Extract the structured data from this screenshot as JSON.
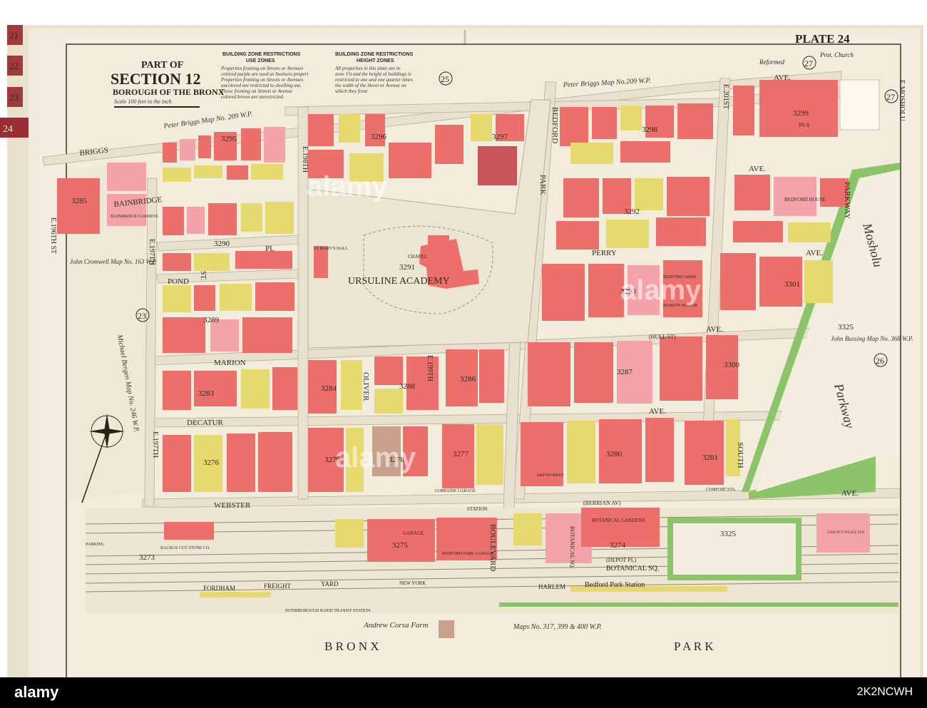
{
  "plate": "PLATE 24",
  "title": {
    "line1": "PART OF",
    "line2": "SECTION 12",
    "line3": "BOROUGH OF THE BRONX",
    "scale": "Scale 100 feet to the inch"
  },
  "legend_use": {
    "heading1": "BUILDING ZONE RESTRICTIONS",
    "heading2": "USE ZONES",
    "lines": [
      "Properties fronting on Streets or Avenues",
      "colored purple are used as business propert",
      "Properties fronting on Streets or Avenues",
      "uncolored are restricted to dwelling use.",
      "Those fronting on Streets or Avenue",
      "colored brown are unrestricted."
    ]
  },
  "legend_height": {
    "heading1": "BUILDING ZONE RESTRICTIONS",
    "heading2": "HEIGHT ZONES",
    "lines": [
      "All properties in this plate are in",
      "zone 1¼ and the height of buildings is",
      "restricted to one and one quarter times",
      "the width of the Street or Avenue on",
      "which they front"
    ]
  },
  "tabs": [
    "21",
    "22",
    "23",
    "24"
  ],
  "streets": {
    "briggs": "BRIGGS",
    "bainbridge": "BAINBRIDGE",
    "pond": "POND",
    "pl": "PL",
    "marion": "MARION",
    "decatur": "DECATUR",
    "webster": "WEBSTER",
    "perry": "PERRY",
    "ave": "AVE.",
    "hull": "(HULL ST)",
    "bedford": "BEDFORD",
    "park": "PARK",
    "boulevard": "BOULEVARD",
    "oliver": "OLIVER",
    "st": "ST.",
    "south": "SOUTH",
    "parkway": "PARKWAY",
    "e196": "E.196TH ST",
    "e197a": "E.197TH",
    "e197b": "E.197TH",
    "e198": "E.198TH",
    "e199": "E.199TH",
    "e201": "E.201ST",
    "mosholu": "E.MOSHOLU",
    "berrian": "(BERRIAN AV)",
    "botanical_sq": "BOTANICAL SQ.",
    "botanical_sq2": "BOTANICAL SQ.",
    "depot": "(DEPOT PL)"
  },
  "blocks": [
    "3285",
    "3295",
    "3296",
    "3297",
    "3298",
    "3299",
    "3290",
    "3291",
    "3292",
    "3293",
    "3301",
    "3289",
    "3283",
    "3284",
    "3286",
    "3287",
    "3288",
    "3300",
    "3276",
    "3279",
    "3278",
    "3277",
    "3280",
    "3281",
    "3273",
    "3275",
    "3274",
    "3325"
  ],
  "places": {
    "ursuline": "URSULINE ACADEMY",
    "chapel": "CHAPEL",
    "st_marys": "ST MARY'S HALL",
    "bedford_house": "BEDFORD HOUSE",
    "bainbridge_gardens": "BAINBRIDGE GARDENS",
    "marion_manor": "MARION MANOR",
    "bedford_arms": "BEDFORD ARMS",
    "lorraine_garage": "LORRAINE GARAGE",
    "ap_market": "A&P MARKET",
    "garage": "GARAGE",
    "bedford_park_garage": "BEDFORD PARK GARAGE",
    "botanical_gardens": "BOTANICAL GARDENS",
    "police": "52ND PCT POLICE STN",
    "ps": "PS 8",
    "comfort": "COMFORT STA.",
    "station": "STATION",
    "bedford_park_sta": "Bedford Park Station",
    "harlem": "HARLEM",
    "fordham": "FORDHAM",
    "freight": "FREIGHT",
    "yard": "YARD",
    "nyc_rr": "NEW YORK",
    "parking": "PARKING",
    "backus": "BACKUS CUT STONE CO.",
    "interborough": "INTERBOROUGH RAPID TRANSIT STATION",
    "reformed": "Reformed",
    "prot": "Prot. Church"
  },
  "maps": {
    "briggs_top": "Peter Briggs Map No.209 W.P.",
    "briggs_left": "Peter Briggs Map No. 209 W.P.",
    "cromwell": "John Cromwell Map No. 163 W.P.",
    "bergen": "Michael Bergen Map No. 246 W.P.",
    "bussing": "John Bussing Map No. 368 W.P.",
    "corsa": "Andrew Corsa Farm",
    "maps_no": "Maps No. 317, 399 & 400 W.P."
  },
  "plate_refs": [
    "25",
    "27",
    "27",
    "23",
    "26"
  ],
  "bottom": {
    "bronx": "B R O N X",
    "park": "P A R K"
  },
  "mosholu_parkway": {
    "m": "Mosholu",
    "p": "Parkway"
  },
  "watermark": "alamy",
  "stock_id": "2K2NCWH",
  "colors": {
    "brick": "#ec6f6c",
    "pink": "#f5a3ab",
    "frame": "#f2a6a6",
    "yellow": "#e6d96e",
    "paper": "#f2ecdc",
    "green": "#8cc46a",
    "bg": "#f3ede0"
  }
}
